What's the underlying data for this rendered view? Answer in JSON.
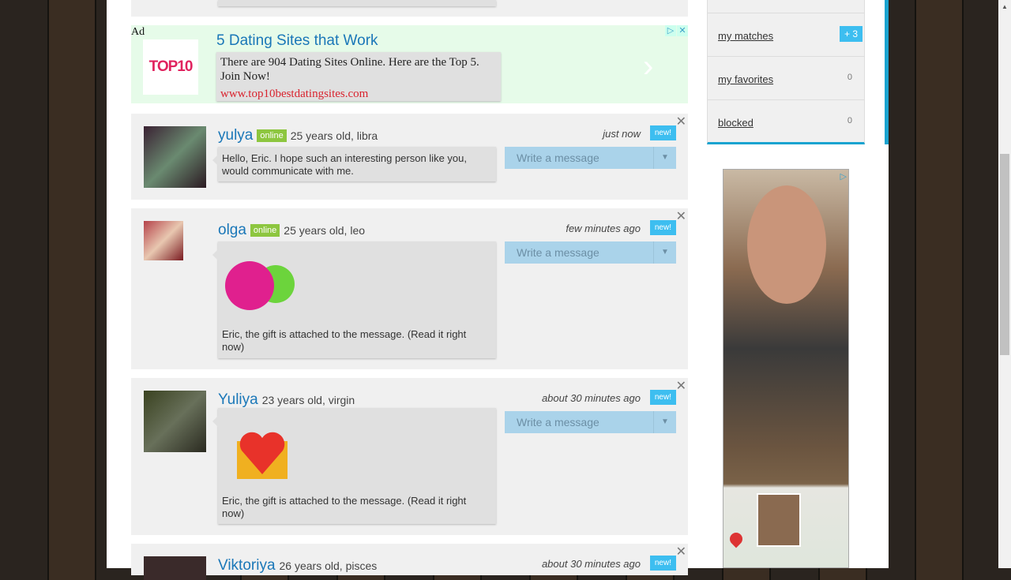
{
  "ad": {
    "label": "Ad",
    "logo": "TOP10",
    "title": "5 Dating Sites that Work",
    "body": "There are 904 Dating Sites Online. Here are the Top 5. Join Now!",
    "url": "www.top10bestdatingsites.com"
  },
  "messages": [
    {
      "name": "yulya",
      "online": "online",
      "meta": "25 years old, libra",
      "text": "Hello, Eric. I hope such an interesting person like you, would communicate with me.",
      "time": "just now",
      "badge": "new!",
      "action": "Write a message"
    },
    {
      "name": "olga",
      "online": "online",
      "meta": "25 years old, leo",
      "text": "Eric, the gift is attached to the message. (Read it right now)",
      "time": "few minutes ago",
      "badge": "new!",
      "action": "Write a message",
      "gift": "balls-gift-icon"
    },
    {
      "name": "Yuliya",
      "meta": "23 years old, virgin",
      "text": "Eric, the gift is attached to the message. (Read it right now)",
      "time": "about 30 minutes ago",
      "badge": "new!",
      "action": "Write a message",
      "gift": "heart-envelope-gift-icon"
    },
    {
      "name": "Viktoriya",
      "meta": "26 years old, pisces",
      "time": "about 30 minutes ago",
      "badge": "new!"
    }
  ],
  "sidebar": {
    "items": [
      {
        "label": "my matches",
        "count": "+ 3"
      },
      {
        "label": "my favorites",
        "count": "0"
      },
      {
        "label": "blocked",
        "count": "0"
      }
    ]
  },
  "colors": {
    "accent": "#1aa3d0",
    "link": "#1a77b8",
    "online": "#8dc63f",
    "badge": "#3dbef0"
  }
}
